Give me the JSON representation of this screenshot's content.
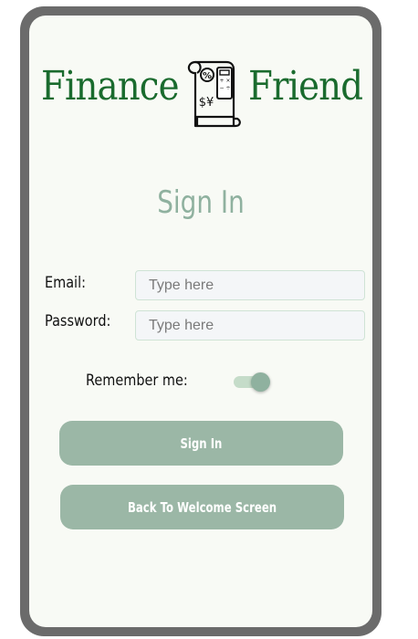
{
  "app": {
    "logo_left": "Finance",
    "logo_right": "Friend",
    "logo_icon": "receipt-calculator-icon"
  },
  "page": {
    "title": "Sign In"
  },
  "form": {
    "email_label": "Email:",
    "email_placeholder": "Type here",
    "email_value": "",
    "password_label": "Password:",
    "password_placeholder": "Type here",
    "password_value": "",
    "remember_label": "Remember me:",
    "remember_checked": true
  },
  "buttons": {
    "sign_in": "Sign In",
    "back": "Back To Welcome Screen"
  },
  "colors": {
    "brand_green": "#1a6b2e",
    "accent_sage": "#8fb19f",
    "button_bg": "#9bb7a6",
    "toggle_track": "#c5dcc9",
    "screen_bg": "#f8faf5",
    "frame": "#6b6b6b"
  }
}
